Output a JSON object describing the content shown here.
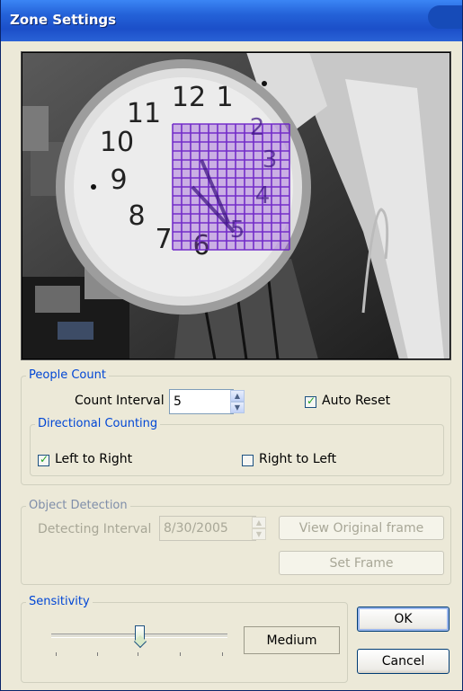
{
  "window": {
    "title": "Zone Settings"
  },
  "camera": {
    "description_icon": "camera-preview"
  },
  "people_count": {
    "legend": "People Count",
    "count_interval_label": "Count Interval :",
    "count_interval_value": "5",
    "auto_reset_label": "Auto Reset",
    "auto_reset_checked": true
  },
  "directional": {
    "legend": "Directional Counting",
    "left_to_right_label": "Left to Right",
    "left_to_right_checked": true,
    "right_to_left_label": "Right to Left",
    "right_to_left_checked": false
  },
  "object_detection": {
    "legend": "Object Detection",
    "detecting_interval_label": "Detecting Interval",
    "detecting_interval_value": "8/30/2005",
    "view_original_label": "View Original frame",
    "set_frame_label": "Set Frame"
  },
  "sensitivity": {
    "legend": "Sensitivity",
    "value_label": "Medium",
    "level_fraction": 0.5
  },
  "buttons": {
    "ok": "OK",
    "cancel": "Cancel"
  },
  "colors": {
    "title_bar": "#2462d8",
    "group_legend": "#0046d5",
    "zone_grid": "#7b2fd1"
  }
}
